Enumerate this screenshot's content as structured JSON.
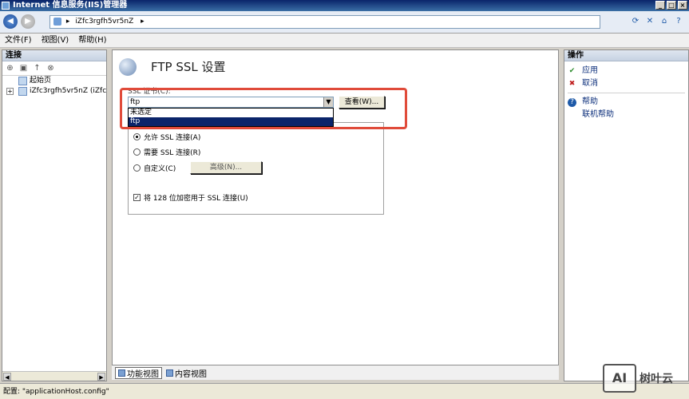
{
  "window": {
    "title": "Internet 信息服务(IIS)管理器",
    "controls": [
      "_",
      "□",
      "×"
    ]
  },
  "address": {
    "separator": "▸",
    "path": "iZfc3rgfh5vr5nZ",
    "trail": "▸"
  },
  "menu": {
    "file": "文件(F)",
    "view": "视图(V)",
    "help": "帮助(H)"
  },
  "left": {
    "header": "连接",
    "tree": [
      {
        "label": "起始页",
        "expander": ""
      },
      {
        "label": "iZfc3rgfh5vr5nZ (iZfc",
        "expander": "+"
      }
    ]
  },
  "center": {
    "title": "FTP SSL 设置",
    "ssl_label": "SSL 证书(C):",
    "combo_value": "ftp",
    "dropdown_options": [
      "未选定",
      "ftp"
    ],
    "view_button": "查看(W)...",
    "options": {
      "allow": "允许 SSL 连接(A)",
      "require": "需要 SSL 连接(R)",
      "custom": "自定义(C)",
      "advanced_button": "高级(N)...",
      "use128": "将 128 位加密用于 SSL 连接(U)"
    }
  },
  "tabs": {
    "feature_view": "功能视图",
    "content_view": "内容视图"
  },
  "right": {
    "header": "操作",
    "actions": {
      "apply": "应用",
      "cancel": "取消",
      "help": "帮助",
      "online_help": "联机帮助"
    }
  },
  "status": {
    "text": "配置: \"applicationHost.config\""
  },
  "watermark": {
    "logo": "AI",
    "text": "树叶云"
  }
}
